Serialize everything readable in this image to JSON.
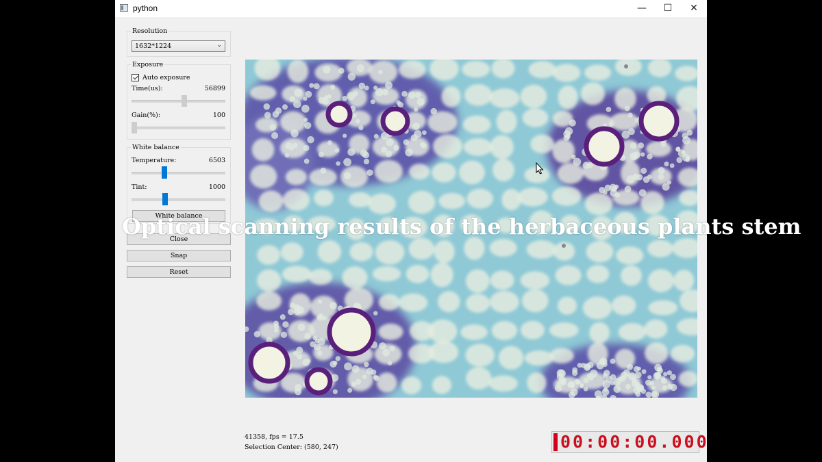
{
  "window": {
    "title": "python"
  },
  "titlebar": {
    "minimize": "—",
    "maximize": "☐",
    "close": "✕"
  },
  "resolution": {
    "title": "Resolution",
    "selected": "1632*1224"
  },
  "exposure": {
    "title": "Exposure",
    "auto_label": "Auto exposure",
    "auto_checked": true,
    "time_label": "Time(us):",
    "time_value": "56899",
    "time_slider_fraction": 0.55,
    "gain_label": "Gain(%):",
    "gain_value": "100",
    "gain_slider_fraction": 0.0
  },
  "white_balance": {
    "title": "White balance",
    "temperature_label": "Temperature:",
    "temperature_value": "6503",
    "temperature_slider_fraction": 0.35,
    "tint_label": "Tint:",
    "tint_value": "1000",
    "tint_slider_fraction": 0.35,
    "button_label": "White balance"
  },
  "buttons": {
    "close": "Close",
    "snap": "Snap",
    "reset": "Reset"
  },
  "overlay": {
    "caption": "Optical scanning results of the herbaceous plants stem"
  },
  "status": {
    "line1": "41358, fps = 17.5",
    "line2": "Selection Center: (580, 247)"
  },
  "timer": {
    "text": "00:00:00.000"
  },
  "colors": {
    "accent_blue": "#0078d7",
    "timer_red": "#c8101e",
    "stain_purple": "#6a2a86",
    "stain_teal": "#8fc9d6"
  },
  "icons": {
    "app": "window-app-icon",
    "cursor": "mouse-pointer-icon"
  }
}
